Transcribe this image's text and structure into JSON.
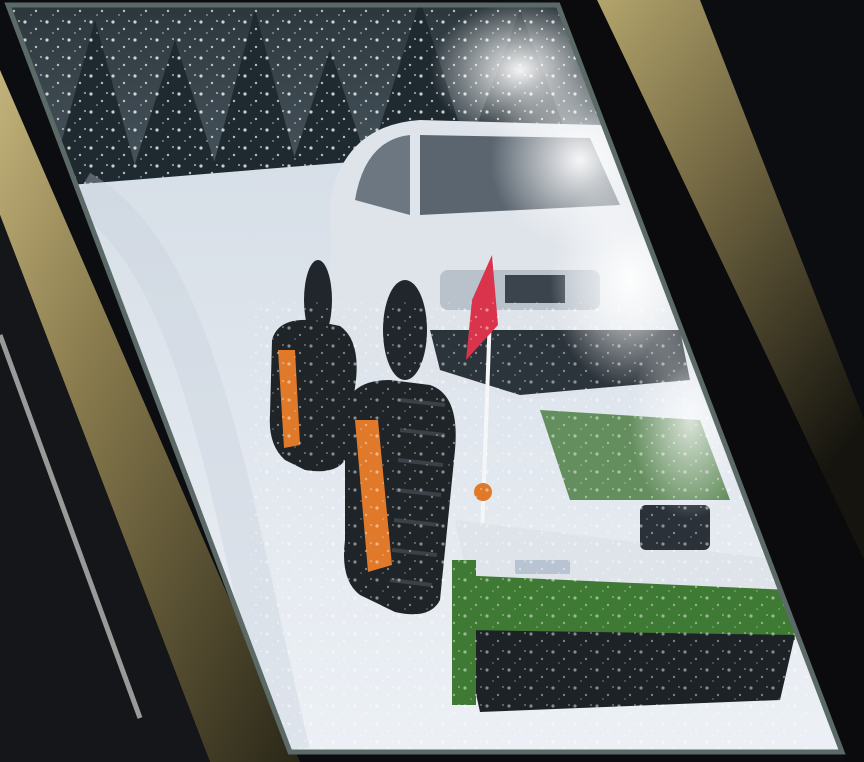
{
  "scene": {
    "subject": "snowblower-on-tracked-vehicle",
    "colors": {
      "background": "#0c0d10",
      "gold_band": "#8a7c4e",
      "gold_band_light": "#b9a870",
      "frame_border": "#5b6a66",
      "snow": "#e6edf4",
      "snow_shadow": "#b8c4d2",
      "truck_body": "#dfe4ea",
      "track_orange": "#e07a2a",
      "blower_green": "#3f7a34",
      "flag_red": "#d9344c",
      "pine_dark": "#1f2a30"
    }
  }
}
